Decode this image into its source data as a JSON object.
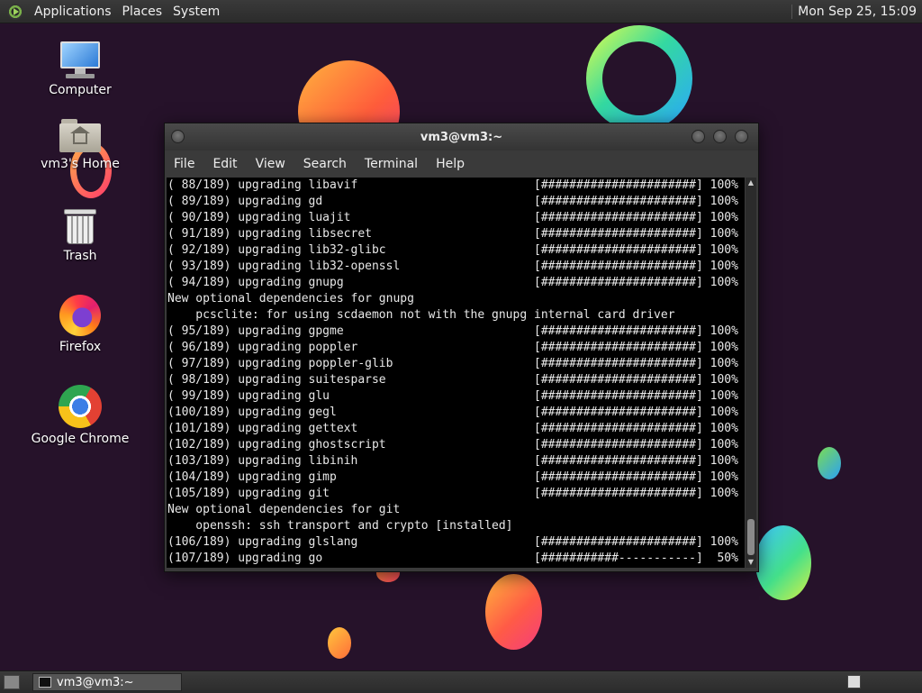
{
  "top_panel": {
    "menus": [
      "Applications",
      "Places",
      "System"
    ],
    "clock": "Mon Sep 25, 15:09"
  },
  "desktop_icons": [
    {
      "label": "Computer",
      "icon": "computer-icon"
    },
    {
      "label": "vm3's Home",
      "icon": "home-folder-icon"
    },
    {
      "label": "Trash",
      "icon": "trash-icon"
    },
    {
      "label": "Firefox",
      "icon": "firefox-icon"
    },
    {
      "label": "Google Chrome",
      "icon": "chrome-icon"
    }
  ],
  "terminal": {
    "title": "vm3@vm3:~",
    "menu": [
      "File",
      "Edit",
      "View",
      "Search",
      "Terminal",
      "Help"
    ],
    "lines": [
      "( 88/189) upgrading libavif                         [######################] 100%",
      "( 89/189) upgrading gd                              [######################] 100%",
      "( 90/189) upgrading luajit                          [######################] 100%",
      "( 91/189) upgrading libsecret                       [######################] 100%",
      "( 92/189) upgrading lib32-glibc                     [######################] 100%",
      "( 93/189) upgrading lib32-openssl                   [######################] 100%",
      "( 94/189) upgrading gnupg                           [######################] 100%",
      "New optional dependencies for gnupg",
      "    pcsclite: for using scdaemon not with the gnupg internal card driver",
      "( 95/189) upgrading gpgme                           [######################] 100%",
      "( 96/189) upgrading poppler                         [######################] 100%",
      "( 97/189) upgrading poppler-glib                    [######################] 100%",
      "( 98/189) upgrading suitesparse                     [######################] 100%",
      "( 99/189) upgrading glu                             [######################] 100%",
      "(100/189) upgrading gegl                            [######################] 100%",
      "(101/189) upgrading gettext                         [######################] 100%",
      "(102/189) upgrading ghostscript                     [######################] 100%",
      "(103/189) upgrading libinih                         [######################] 100%",
      "(104/189) upgrading gimp                            [######################] 100%",
      "(105/189) upgrading git                             [######################] 100%",
      "New optional dependencies for git",
      "    openssh: ssh transport and crypto [installed]",
      "(106/189) upgrading glslang                         [######################] 100%",
      "(107/189) upgrading go                              [###########-----------]  50%"
    ]
  },
  "taskbar": {
    "window_button": "vm3@vm3:~"
  }
}
